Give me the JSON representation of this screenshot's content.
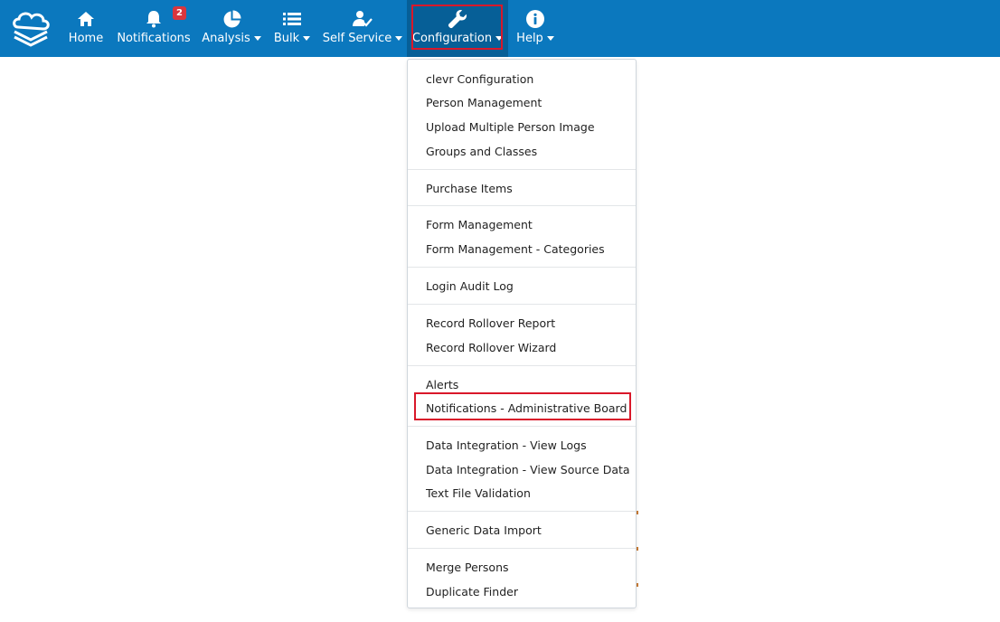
{
  "nav": {
    "items": [
      {
        "label": "Home",
        "icon": "home-icon"
      },
      {
        "label": "Notifications",
        "icon": "bell-icon",
        "badge": "2"
      },
      {
        "label": "Analysis",
        "icon": "pie-chart-icon"
      },
      {
        "label": "Bulk",
        "icon": "list-icon"
      },
      {
        "label": "Self Service",
        "icon": "user-check-icon"
      },
      {
        "label": "Configuration",
        "icon": "wrench-icon"
      },
      {
        "label": "Help",
        "icon": "info-icon"
      }
    ]
  },
  "dropdown": {
    "items": [
      "clevr Configuration",
      "Person Management",
      "Upload Multiple Person Image",
      "Groups and Classes",
      "Purchase Items",
      "Form Management",
      "Form Management - Categories",
      "Login Audit Log",
      "Record Rollover Report",
      "Record Rollover Wizard",
      "Alerts",
      "Notifications - Administrative Board",
      "Data Integration - View Logs",
      "Data Integration - View Source Data",
      "Text File Validation",
      "Generic Data Import",
      "Merge Persons",
      "Duplicate Finder"
    ]
  },
  "colors": {
    "navbar": "#0b78be",
    "active": "#065f97",
    "highlight": "#d9182a",
    "badge": "#d9363e"
  }
}
